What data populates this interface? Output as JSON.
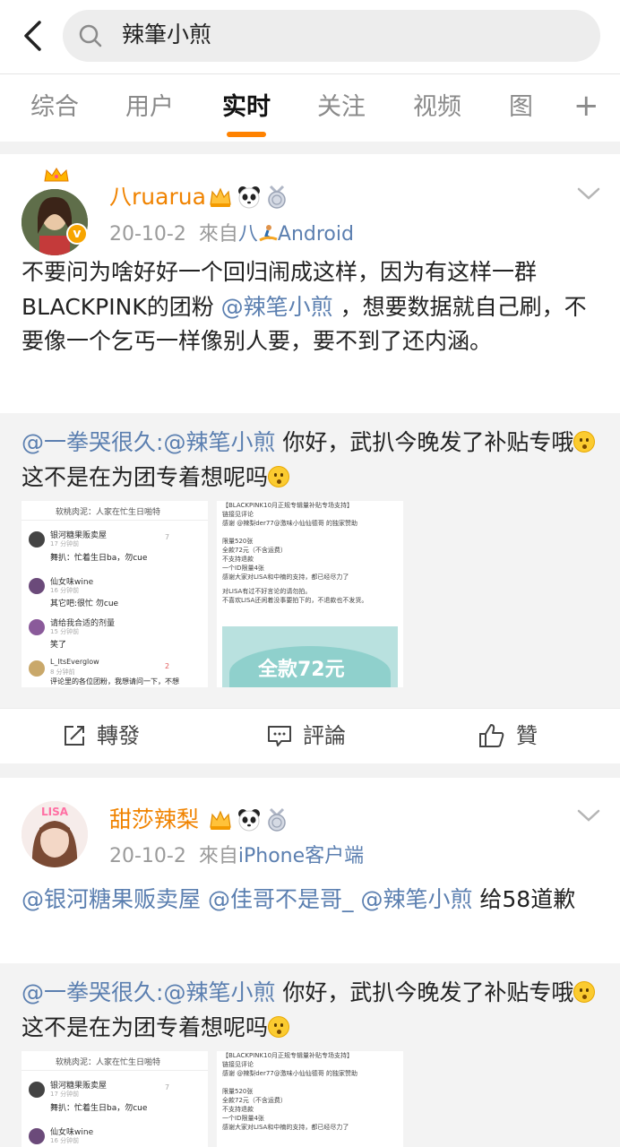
{
  "search": {
    "query": "辣筆小煎"
  },
  "tabs": [
    "综合",
    "用户",
    "实时",
    "关注",
    "视频",
    "图"
  ],
  "posts": [
    {
      "username": "八ruarua",
      "date": "20-10-2",
      "source_prefix": "來自",
      "source_emoji_text": "八",
      "source": "Android",
      "text_parts": [
        "不要问为啥好好一个回归闹成这样，因为有这样一群BLACKPINK的团粉 ",
        "@辣笔小煎",
        " ，想要数据就自己刷，不要像一个乞丐一样像别人要，要不到了还内涵。"
      ],
      "quote": {
        "author": "@一拳哭很久",
        "mention": ":@辣笔小煎",
        "text_a": " 你好，武扒今晚发了补贴专哦",
        "text_b": "这不是在为团专着想呢吗"
      },
      "thumb_left": {
        "header": "软桃肉泥：人家在忙生日啪特",
        "comments": [
          {
            "name": "银河糖果贩卖屋",
            "time": "17 分钟前",
            "text": "舞扒：忙着生日ba，勿cue",
            "likes": "7"
          },
          {
            "name": "仙女味wine",
            "time": "16 分钟前",
            "text": "其它吧:很忙  勿cue",
            "likes": ""
          },
          {
            "name": "请给我合适的剂量",
            "time": "15 分钟前",
            "text": "笑了",
            "likes": ""
          },
          {
            "name": "L_ItsEverglow",
            "time": "8 分钟前",
            "text": "评论里的各位团粉，我想请问一下，不想",
            "likes": "2"
          }
        ]
      },
      "thumb_right": {
        "lines": [
          "【BLACKPINK10月正规专辑量补贴专场支持】",
          "链接见评论",
          "感谢 @辣梨der77@激味小仙仙德哥 的独家赞助",
          "限量520张",
          "全款72元（不含运费）",
          "不支持退款",
          "一个ID限量4张",
          "感谢大家对LISA和中楠的支持，都已经尽力了",
          "对LISA有过不好言论的请勿拍。",
          "不喜欢LISA还闲着没事要拍下的，不退款也不发货。"
        ],
        "banner": "全款72元"
      },
      "actions": {
        "repost": "轉發",
        "comment": "評論",
        "like": "贊"
      }
    },
    {
      "username": "甜莎辣梨",
      "date": "20-10-2",
      "source_prefix": "來自",
      "source": "iPhone客户端",
      "mentions": [
        "@银河糖果贩卖屋",
        "@佳哥不是哥_",
        "@辣笔小煎"
      ],
      "text_tail": " 给58道歉",
      "quote": {
        "author": "@一拳哭很久",
        "mention": ":@辣笔小煎",
        "text_a": " 你好，武扒今晚发了补贴专哦",
        "text_b": "这不是在为团专着想呢吗"
      },
      "thumb_left": {
        "header": "软桃肉泥：人家在忙生日啪特",
        "comments": [
          {
            "name": "银河糖果贩卖屋",
            "time": "17 分钟前",
            "text": "舞扒：忙着生日ba，勿cue",
            "likes": "7"
          },
          {
            "name": "仙女味wine",
            "time": "16 分钟前",
            "text": "",
            "likes": ""
          }
        ]
      },
      "thumb_right": {
        "lines": [
          "【BLACKPINK10月正规专辑量补贴专场支持】",
          "链接见评论",
          "感谢 @辣梨der77@激味小仙仙德哥 的独家赞助",
          "限量520张",
          "全款72元（不含运费）",
          "不支持退款",
          "一个ID限量4张",
          "感谢大家对LISA和中楠的支持，都已经尽力了"
        ]
      }
    }
  ],
  "colors": {
    "accent": "#ff8200",
    "link": "#5b7fb0",
    "username": "#f08300"
  }
}
